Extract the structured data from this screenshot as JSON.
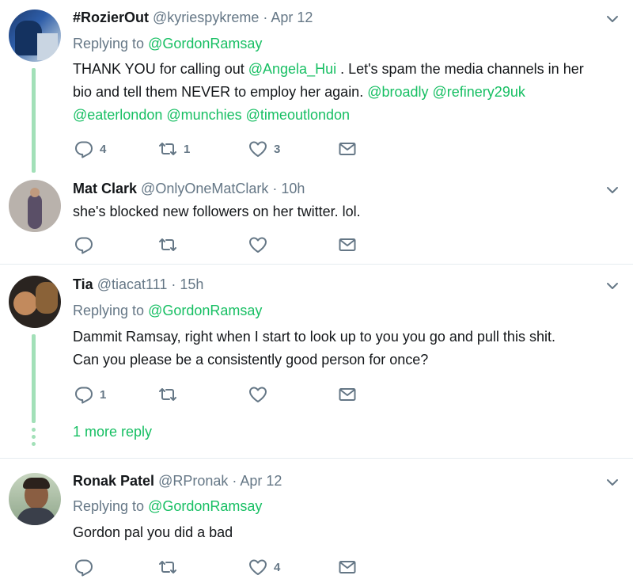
{
  "tweets": [
    {
      "name": "#RozierOut",
      "handle": "@kyriespykreme",
      "time": "· Apr 12",
      "replying_label": "Replying to",
      "replying_to": "@GordonRamsay",
      "text_parts": [
        "THANK YOU for calling out ",
        "@Angela_Hui",
        " . Let's spam the media channels in her",
        "bio and tell them NEVER to employ her again. ",
        "@broadly @refinery29uk",
        "@eaterlondon @munchies @timeoutlondon"
      ],
      "replies": "4",
      "retweets": "1",
      "likes": "3"
    },
    {
      "name": "Mat Clark",
      "handle": "@OnlyOneMatClark",
      "time": "· 10h",
      "text": "she's blocked new followers on her twitter. lol.",
      "replies": "",
      "retweets": "",
      "likes": ""
    },
    {
      "name": "Tia",
      "handle": "@tiacat111",
      "time": "· 15h",
      "replying_label": "Replying to",
      "replying_to": "@GordonRamsay",
      "text_line1": "Dammit Ramsay, right when I start to look up to you you go and pull this shit.",
      "text_line2": "Can you please be a consistently good person for once?",
      "replies": "1",
      "retweets": "",
      "likes": "",
      "more_reply": "1 more reply"
    },
    {
      "name": "Ronak Patel",
      "handle": "@RPronak",
      "time": "· Apr 12",
      "replying_label": "Replying to",
      "replying_to": "@GordonRamsay",
      "text": "Gordon pal you did a bad",
      "replies": "",
      "retweets": "",
      "likes": "4"
    }
  ],
  "icons": {
    "reply": "reply-icon",
    "retweet": "retweet-icon",
    "like": "heart-icon",
    "dm": "envelope-icon",
    "menu": "chevron-down-icon"
  },
  "colors": {
    "accent": "#17bf63",
    "thread": "#a2e0b8",
    "muted": "#657786",
    "text": "#14171a"
  }
}
